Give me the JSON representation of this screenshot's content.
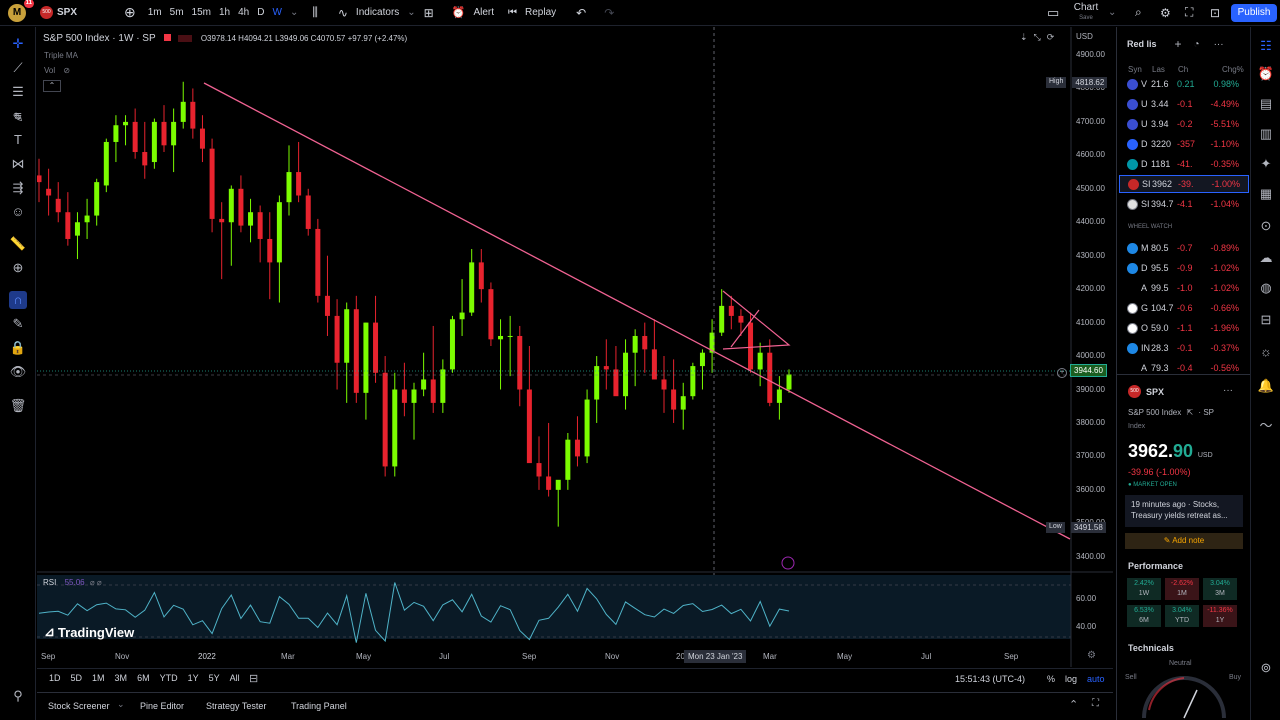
{
  "topbar": {
    "symbol": "SPX",
    "intervals": [
      "1m",
      "5m",
      "15m",
      "1h",
      "4h",
      "D",
      "W"
    ],
    "indicators": "Indicators",
    "alert": "Alert",
    "replay": "Replay",
    "chart_label": "Chart",
    "chart_sub": "Save",
    "publish": "Publish",
    "badge": "11",
    "avatar": "M"
  },
  "legend": {
    "title": "S&P 500 Index · 1W · SP",
    "ohlc": "O3978.14  H4094.21  L3949.06  C4070.57  +97.97 (+2.47%)",
    "ma": "Triple MA",
    "vol": "Vol"
  },
  "price_axis": {
    "currency": "USD",
    "ticks": [
      "4900.00",
      "4800.00",
      "4700.00",
      "4600.00",
      "4500.00",
      "4400.00",
      "4300.00",
      "4200.00",
      "4100.00",
      "4000.00",
      "3900.00",
      "3800.00",
      "3700.00",
      "3600.00",
      "3500.00",
      "3400.00"
    ],
    "high_label": "High",
    "high_value": "4818.62",
    "low_label": "Low",
    "low_value": "3491.58",
    "current": "3944.60",
    "rsi_ticks": [
      "60.00",
      "40.00"
    ]
  },
  "time_axis": {
    "ticks": [
      "Sep",
      "Nov",
      "2022",
      "Mar",
      "May",
      "Jul",
      "Sep",
      "Nov",
      "20",
      "Mar",
      "May",
      "Jul",
      "Sep"
    ],
    "crosshair": "Mon 23 Jan '23"
  },
  "rsi": {
    "label": "RSI",
    "value": "55.06"
  },
  "watermark": "TradingView",
  "bottombar": {
    "ranges": [
      "1D",
      "5D",
      "1M",
      "3M",
      "6M",
      "YTD",
      "1Y",
      "5Y",
      "All"
    ],
    "time": "15:51:43 (UTC-4)",
    "pct": "%",
    "log": "log",
    "auto": "auto"
  },
  "footer": {
    "tabs": [
      "Stock Screener",
      "Pine Editor",
      "Strategy Tester",
      "Trading Panel"
    ]
  },
  "watchlist": {
    "title": "Red lis",
    "columns": [
      "Syn",
      "Las",
      "Ch",
      "Chg%"
    ],
    "rows": [
      {
        "sym": "V",
        "last": "21.6",
        "ch": "0.21",
        "pct": "0.98%",
        "dir": "pos",
        "icon": "#3a4ed1"
      },
      {
        "sym": "U",
        "last": "3.44",
        "ch": "-0.1",
        "pct": "-4.49%",
        "dir": "neg",
        "icon": "#3a4ed1"
      },
      {
        "sym": "U",
        "last": "3.94",
        "ch": "-0.2",
        "pct": "-5.51%",
        "dir": "neg",
        "icon": "#3a4ed1"
      },
      {
        "sym": "D",
        "last": "3220",
        "ch": "-357",
        "pct": "-1.10%",
        "dir": "neg",
        "icon": "#2962ff"
      },
      {
        "sym": "D",
        "last": "1181",
        "ch": "-41.",
        "pct": "-0.35%",
        "dir": "neg",
        "icon": "#0097a7"
      },
      {
        "sym": "SI",
        "last": "3962",
        "ch": "-39.",
        "pct": "-1.00%",
        "dir": "neg",
        "icon": "#c62828"
      },
      {
        "sym": "SI",
        "last": "394.7",
        "ch": "-4.1",
        "pct": "-1.04%",
        "dir": "neg",
        "icon": "#e0e0e0"
      }
    ],
    "section": "WHEEL WATCH",
    "rows2": [
      {
        "sym": "M",
        "last": "80.5",
        "ch": "-0.7",
        "pct": "-0.89%",
        "dir": "neg",
        "icon": "#1e88e5"
      },
      {
        "sym": "D",
        "last": "95.5",
        "ch": "-0.9",
        "pct": "-1.02%",
        "dir": "neg",
        "icon": "#1e88e5"
      },
      {
        "sym": "A",
        "last": "99.5",
        "ch": "-1.0",
        "pct": "-1.02%",
        "dir": "neg",
        "icon": "#000000"
      },
      {
        "sym": "G",
        "last": "104.7",
        "ch": "-0.6",
        "pct": "-0.66%",
        "dir": "neg",
        "icon": "#ffffff"
      },
      {
        "sym": "O",
        "last": "59.0",
        "ch": "-1.1",
        "pct": "-1.96%",
        "dir": "neg",
        "icon": "#ffffff"
      },
      {
        "sym": "IN",
        "last": "28.3",
        "ch": "-0.1",
        "pct": "-0.37%",
        "dir": "neg",
        "icon": "#1e88e5"
      },
      {
        "sym": "A",
        "last": "79.3",
        "ch": "-0.4",
        "pct": "-0.56%",
        "dir": "neg",
        "icon": "#000000"
      }
    ]
  },
  "details": {
    "symbol": "SPX",
    "badge": "500",
    "name": "S&P 500 Index",
    "exchange": "SP",
    "type": "Index",
    "price_main": "3962.",
    "price_dec": "90",
    "currency": "USD",
    "change": "-39.96 (-1.00%)",
    "status": "MARKET OPEN",
    "news": "19 minutes ago · Stocks, Treasury yields retreat as...",
    "add_note": "Add note",
    "performance": "Performance",
    "perf": [
      {
        "v": "2.42%",
        "l": "1W",
        "dir": "pos"
      },
      {
        "v": "-2.62%",
        "l": "1M",
        "dir": "neg"
      },
      {
        "v": "3.04%",
        "l": "3M",
        "dir": "pos"
      },
      {
        "v": "6.53%",
        "l": "6M",
        "dir": "pos"
      },
      {
        "v": "3.04%",
        "l": "YTD",
        "dir": "pos"
      },
      {
        "v": "-11.36%",
        "l": "1Y",
        "dir": "neg"
      }
    ],
    "technicals": "Technicals",
    "gauge": {
      "neutral": "Neutral",
      "sell": "Sell",
      "buy": "Buy"
    }
  },
  "candles": [
    [
      4540,
      4590,
      4460,
      4520
    ],
    [
      4500,
      4560,
      4420,
      4480
    ],
    [
      4470,
      4520,
      4400,
      4430
    ],
    [
      4430,
      4490,
      4330,
      4350
    ],
    [
      4360,
      4430,
      4290,
      4400
    ],
    [
      4400,
      4470,
      4350,
      4420
    ],
    [
      4420,
      4530,
      4390,
      4520
    ],
    [
      4510,
      4650,
      4490,
      4640
    ],
    [
      4640,
      4720,
      4580,
      4690
    ],
    [
      4690,
      4720,
      4630,
      4700
    ],
    [
      4700,
      4740,
      4590,
      4610
    ],
    [
      4610,
      4700,
      4530,
      4570
    ],
    [
      4580,
      4710,
      4560,
      4700
    ],
    [
      4700,
      4750,
      4610,
      4630
    ],
    [
      4630,
      4740,
      4550,
      4700
    ],
    [
      4700,
      4820,
      4680,
      4760
    ],
    [
      4760,
      4800,
      4650,
      4680
    ],
    [
      4680,
      4720,
      4580,
      4620
    ],
    [
      4620,
      4650,
      4370,
      4410
    ],
    [
      4410,
      4460,
      4230,
      4400
    ],
    [
      4400,
      4510,
      4270,
      4500
    ],
    [
      4500,
      4540,
      4370,
      4390
    ],
    [
      4390,
      4470,
      4340,
      4430
    ],
    [
      4430,
      4450,
      4280,
      4350
    ],
    [
      4350,
      4430,
      4170,
      4280
    ],
    [
      4280,
      4480,
      4160,
      4460
    ],
    [
      4460,
      4630,
      4420,
      4550
    ],
    [
      4550,
      4640,
      4460,
      4480
    ],
    [
      4480,
      4500,
      4360,
      4380
    ],
    [
      4380,
      4410,
      4160,
      4180
    ],
    [
      4180,
      4300,
      4060,
      4120
    ],
    [
      4120,
      4170,
      3900,
      3980
    ],
    [
      3980,
      4160,
      3860,
      4140
    ],
    [
      4140,
      4180,
      3860,
      3890
    ],
    [
      3890,
      4100,
      3810,
      4100
    ],
    [
      4100,
      4180,
      3920,
      3950
    ],
    [
      3950,
      4000,
      3640,
      3670
    ],
    [
      3670,
      3950,
      3640,
      3900
    ],
    [
      3900,
      3980,
      3820,
      3860
    ],
    [
      3860,
      3920,
      3750,
      3900
    ],
    [
      3900,
      4010,
      3880,
      3930
    ],
    [
      3930,
      4090,
      3830,
      3860
    ],
    [
      3860,
      3990,
      3830,
      3960
    ],
    [
      3960,
      4120,
      3950,
      4110
    ],
    [
      4110,
      4230,
      4060,
      4130
    ],
    [
      4130,
      4320,
      4120,
      4280
    ],
    [
      4280,
      4320,
      4160,
      4200
    ],
    [
      4200,
      4220,
      4030,
      4050
    ],
    [
      4050,
      4110,
      3900,
      4060
    ],
    [
      4060,
      4120,
      3940,
      4060
    ],
    [
      4060,
      4090,
      3850,
      3900
    ],
    [
      3900,
      4030,
      3720,
      3680
    ],
    [
      3680,
      3760,
      3600,
      3640
    ],
    [
      3640,
      3800,
      3580,
      3600
    ],
    [
      3600,
      3620,
      3490,
      3630
    ],
    [
      3630,
      3770,
      3600,
      3750
    ],
    [
      3750,
      3820,
      3670,
      3700
    ],
    [
      3700,
      3900,
      3680,
      3870
    ],
    [
      3870,
      4000,
      3800,
      3970
    ],
    [
      3970,
      4050,
      3900,
      3960
    ],
    [
      3960,
      4030,
      3890,
      3880
    ],
    [
      3880,
      4050,
      3840,
      4010
    ],
    [
      4010,
      4080,
      3910,
      4060
    ],
    [
      4060,
      4100,
      3950,
      4020
    ],
    [
      4020,
      4110,
      3940,
      3930
    ],
    [
      3930,
      4000,
      3830,
      3900
    ],
    [
      3900,
      3990,
      3800,
      3840
    ],
    [
      3840,
      3920,
      3780,
      3880
    ],
    [
      3880,
      3980,
      3870,
      3970
    ],
    [
      3970,
      4020,
      3900,
      4010
    ],
    [
      4010,
      4110,
      3950,
      4070
    ],
    [
      4070,
      4200,
      4060,
      4150
    ],
    [
      4150,
      4180,
      4080,
      4120
    ],
    [
      4120,
      4140,
      4060,
      4100
    ],
    [
      4100,
      4130,
      3950,
      3960
    ],
    [
      3960,
      4040,
      3910,
      4010
    ],
    [
      4010,
      4050,
      3850,
      3860
    ],
    [
      3860,
      3940,
      3810,
      3900
    ],
    [
      3900,
      3960,
      3890,
      3945
    ]
  ]
}
